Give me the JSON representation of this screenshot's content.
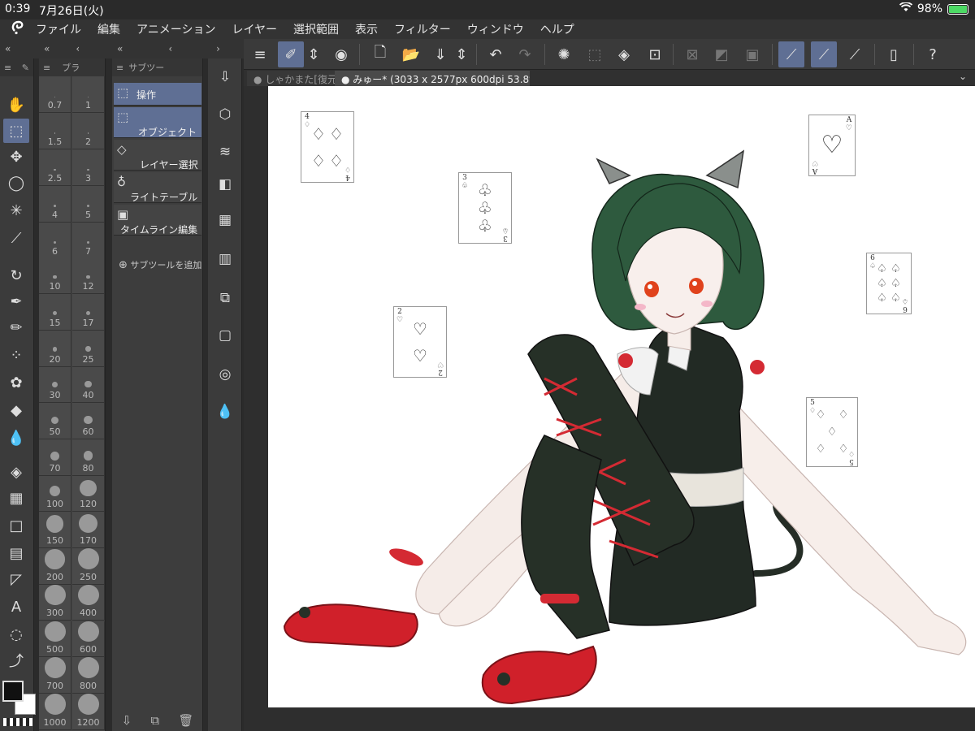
{
  "status": {
    "time": "0:39",
    "date": "7月26日(火)",
    "battery": "98%",
    "battery_level": 0.98
  },
  "menu": [
    "ファイル",
    "編集",
    "アニメーション",
    "レイヤー",
    "選択範囲",
    "表示",
    "フィルター",
    "ウィンドウ",
    "ヘルプ"
  ],
  "panels": {
    "brush_header": "ブラ",
    "subtool_header": "サブツー"
  },
  "brush_sizes": [
    "0.7",
    "1",
    "1.5",
    "2",
    "2.5",
    "3",
    "4",
    "5",
    "6",
    "7",
    "10",
    "12",
    "15",
    "17",
    "20",
    "25",
    "30",
    "40",
    "50",
    "60",
    "70",
    "80",
    "100",
    "120",
    "150",
    "170",
    "200",
    "250",
    "300",
    "400",
    "500",
    "600",
    "700",
    "800",
    "1000",
    "1200"
  ],
  "subtools": [
    {
      "label": "操作",
      "selected": true
    },
    {
      "label": "オブジェクト",
      "selected": true
    },
    {
      "label": "レイヤー選択",
      "selected": false
    },
    {
      "label": "ライトテーブル",
      "selected": false
    },
    {
      "label": "タイムライン編集",
      "selected": false
    }
  ],
  "add_subtool": "サブツールを追加",
  "tabs": [
    {
      "label": "しゃかまた[復元"
    },
    {
      "label": "みゅー* (3033 x 2577px 600dpi 53.8%)"
    }
  ],
  "cards": [
    {
      "rank": "4",
      "suit": "♢"
    },
    {
      "rank": "3",
      "suit": "♧"
    },
    {
      "rank": "A",
      "suit": "♡"
    },
    {
      "rank": "6",
      "suit": "♤"
    },
    {
      "rank": "2",
      "suit": "♡"
    },
    {
      "rank": "5",
      "suit": "♢"
    }
  ],
  "colors": {
    "accent": "#5f6f94",
    "canvas_bg": "#ffffff",
    "ui_dark": "#3b3b3b",
    "hair": "#2e5a3e",
    "shoe": "#d0202a",
    "stocking": "#263027"
  },
  "icons": {
    "tools": [
      "hand-icon",
      "object-icon",
      "move-icon",
      "lasso-icon",
      "magic-wand-icon",
      "eyedropper-icon",
      "pen-icon",
      "pencil-icon",
      "brush-icon",
      "airbrush-icon",
      "decoration-icon",
      "eraser-icon",
      "blend-icon",
      "fill-icon",
      "gradient-icon",
      "rectangle-icon",
      "frame-icon",
      "ruler-icon",
      "text-icon",
      "balloon-icon",
      "correct-line-icon"
    ],
    "side": [
      "import-icon",
      "3d-object-icon",
      "layers-icon",
      "navigator-icon",
      "color-set-icon",
      "timeline-icon",
      "layer-property-icon",
      "sub-view-icon",
      "search-icon",
      "blend-mode-icon"
    ]
  }
}
